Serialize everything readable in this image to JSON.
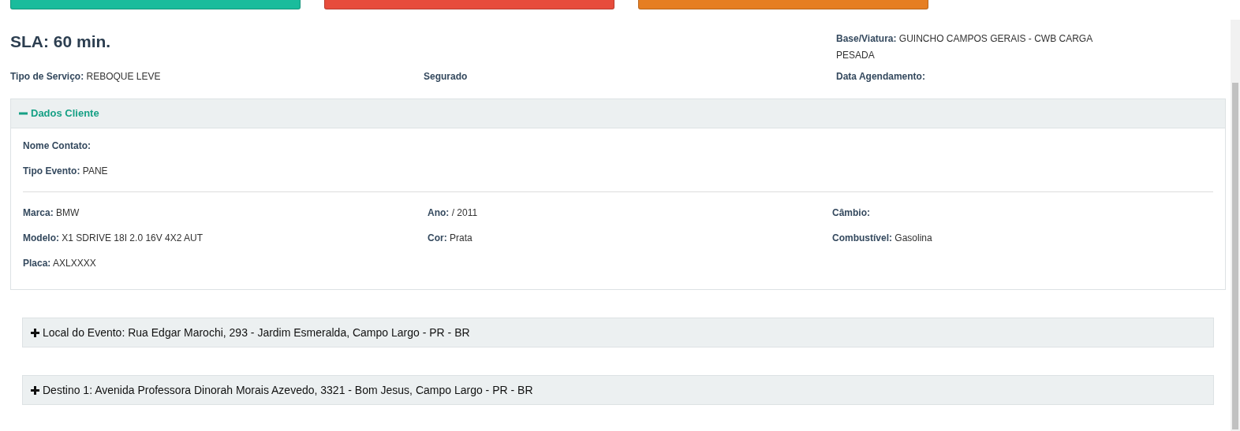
{
  "action_buttons": [
    {
      "color": "#1abc9c"
    },
    {
      "color": "#e74c3c"
    },
    {
      "color": "#e67e22"
    }
  ],
  "sla": "SLA: 60 min.",
  "summary": [
    {
      "label": "Tipo de Serviço:",
      "value": "REBOQUE LEVE"
    },
    {
      "label": "Segurado"
    },
    {
      "label": "Base/Viatura:",
      "value": "GUINCHO CAMPOS GERAIS - CWB CARGA PESADA"
    },
    {
      "label": "Data Agendamento:"
    }
  ],
  "client_panel": {
    "title": "Dados Cliente",
    "expanded": true,
    "contact": [
      {
        "label": "Nome Contato:"
      },
      {
        "label": "Tipo Evento:",
        "value": "PANE"
      }
    ],
    "vehicle": [
      {
        "label": "Marca:",
        "value": "BMW"
      },
      {
        "label": "Ano:",
        "value": "/ 2011"
      },
      {
        "label": "Câmbio:"
      },
      {
        "label": "Modelo:",
        "value": "X1 SDRIVE 18I 2.0 16V 4X2 AUT"
      },
      {
        "label": "Cor:",
        "value": "Prata"
      },
      {
        "label": "Combustível:",
        "value": "Gasolina"
      },
      {
        "label": "Placa:",
        "value": "AXLXXXX"
      }
    ]
  },
  "location_panels": [
    {
      "title": "Local do Evento: Rua Edgar Marochi, 293 - Jardim Esmeralda, Campo Largo - PR - BR",
      "expanded": false
    },
    {
      "title": "Destino 1: Avenida Professora Dinorah Morais Azevedo, 3321 - Bom Jesus, Campo Largo - PR - BR",
      "expanded": false
    }
  ]
}
